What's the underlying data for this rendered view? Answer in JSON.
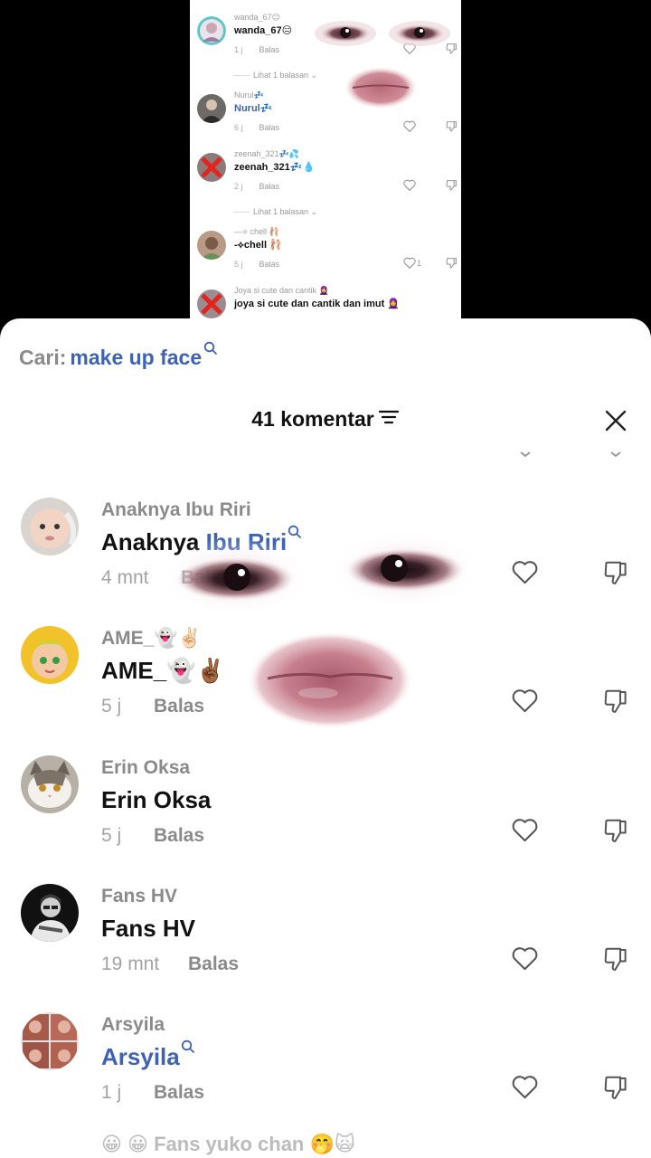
{
  "video": {
    "comments": [
      {
        "username": "wanda_67😑",
        "text": "wanda_67😑",
        "time": "1 j",
        "reply": "Balas",
        "likes": "",
        "blue": false
      },
      {
        "username": "Nurul💤",
        "text": "Nurul💤",
        "time": "6 j",
        "reply": "Balas",
        "likes": "",
        "blue": true
      },
      {
        "username": "zeenah_321💤💦",
        "text": "zeenah_321💤💧",
        "time": "2 j",
        "reply": "Balas",
        "likes": "",
        "blue": false
      },
      {
        "username": "—⟡ chell 🩰",
        "text": "-⟡chell 🩰",
        "time": "5 j",
        "reply": "Balas",
        "likes": "1",
        "blue": false
      },
      {
        "username": "Joya si cute dan cantik 🧕",
        "text": "joya si cute dan cantik dan imut 🧕",
        "time": "",
        "reply": "",
        "likes": "",
        "blue": false
      }
    ],
    "replies_label_1": "Lihat 1 balasan ⌄",
    "replies_label_2": "Lihat 1 balasan ⌄"
  },
  "search": {
    "prefix": "Cari:",
    "query": "make up face"
  },
  "header": {
    "title": "41 komentar"
  },
  "comments": [
    {
      "username": "Anaknya Ibu Riri",
      "text_plain": "Anaknya ",
      "text_highlight": "Ibu Riri",
      "time": "4 mnt",
      "reply": "Balas"
    },
    {
      "username": "AME_👻✌🏻",
      "text": "AME_👻✌🏾",
      "time": "5 j",
      "reply": "Balas"
    },
    {
      "username": "Erin Oksa",
      "text": "Erin Oksa",
      "time": "5 j",
      "reply": "Balas"
    },
    {
      "username": "Fans HV",
      "text": "Fans HV",
      "time": "19 mnt",
      "reply": "Balas"
    },
    {
      "username": "Arsyila",
      "text": "Arsyila",
      "time": "1 j",
      "reply": "Balas"
    }
  ],
  "bottom_peek": "😀 😀 Fans yuko chan 🤭🙀",
  "colors": {
    "accent_blue": "#3e63b4",
    "muted_gray": "#8a8a8a",
    "text_dark": "#111111"
  },
  "icons": [
    "search-icon",
    "filter-icon",
    "close-icon",
    "heart-icon",
    "dislike-icon"
  ]
}
